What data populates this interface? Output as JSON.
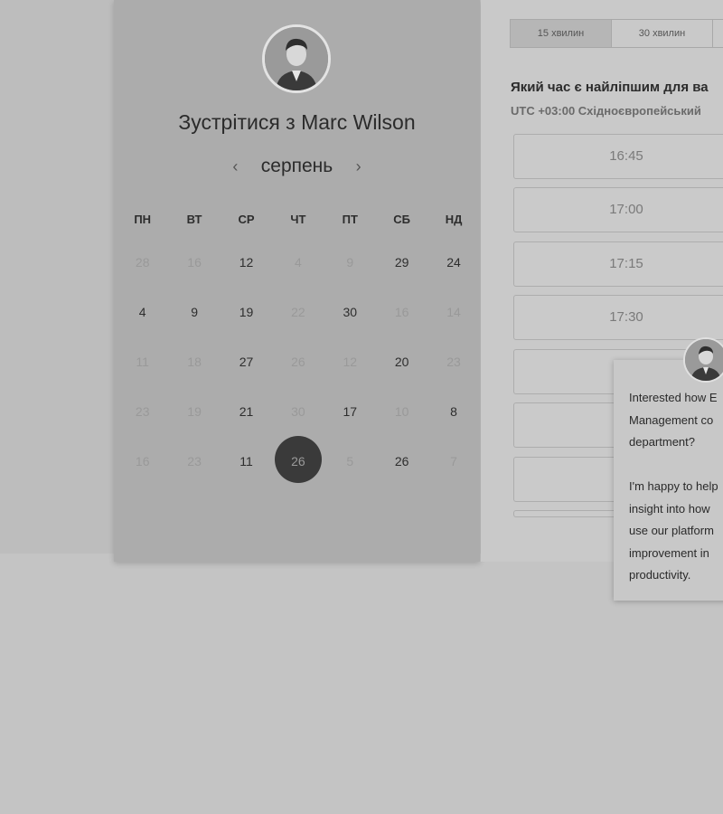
{
  "booking": {
    "host_title": "Зустрітися з Marc Wilson",
    "month": "серпень",
    "prev_icon": "chevron-left-icon",
    "next_icon": "chevron-right-icon",
    "weekdays": [
      "ПН",
      "ВТ",
      "СР",
      "ЧТ",
      "ПТ",
      "СБ",
      "НД"
    ],
    "days": {
      "r0": [
        "28",
        "16",
        "12",
        "4",
        "9",
        "29",
        "24"
      ],
      "r1": [
        "4",
        "9",
        "19",
        "22",
        "30",
        "16",
        "14"
      ],
      "r2": [
        "11",
        "18",
        "27",
        "26",
        "12",
        "20",
        "23"
      ],
      "r3": [
        "23",
        "19",
        "21",
        "30",
        "17",
        "10",
        "8"
      ],
      "r4": [
        "16",
        "23",
        "11",
        "26",
        "5",
        "26",
        "7"
      ]
    },
    "selected_day": "26"
  },
  "scheduler": {
    "durations": [
      "15 хвилин",
      "30 хвилин"
    ],
    "best_time_heading": "Який час є найліпшим для ва",
    "timezone": "UTC +03:00 Східноєвропейський",
    "slots": [
      "16:45",
      "17:00",
      "17:15",
      "17:30"
    ]
  },
  "chat": {
    "lines_p1": [
      "Interested how E",
      "Management co",
      "department?"
    ],
    "lines_p2": [
      "I'm happy to help",
      "insight into how",
      "use our platform",
      "improvement in",
      "productivity."
    ]
  },
  "colors": {
    "calendar_panel": "#acacac",
    "selected_day_bg": "#3a3a3a"
  }
}
